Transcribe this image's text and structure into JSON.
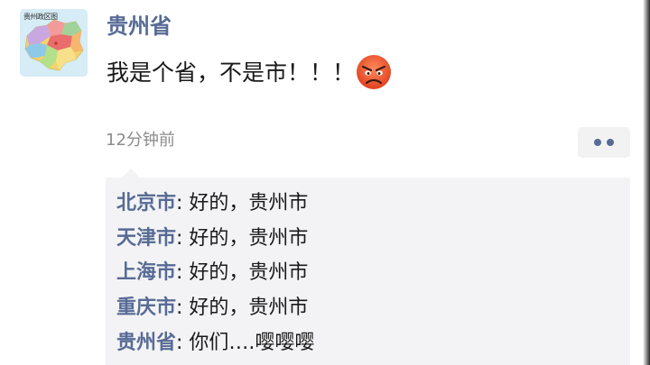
{
  "post": {
    "author": "贵州省",
    "avatar_caption": "贵州政区图",
    "text": "我是个省，不是市！！！",
    "emoji": "angry-face-icon",
    "time": "12分钟前"
  },
  "comments": [
    {
      "name": "北京市",
      "sep": ": ",
      "text": "好的，贵州市"
    },
    {
      "name": "天津市",
      "sep": ": ",
      "text": "好的，贵州市"
    },
    {
      "name": "上海市",
      "sep": ": ",
      "text": "好的，贵州市"
    },
    {
      "name": "重庆市",
      "sep": ": ",
      "text": "好的，贵州市"
    },
    {
      "name": "贵州省",
      "sep": ": ",
      "text": "你们….嘤嘤嘤"
    }
  ],
  "colors": {
    "name_link": "#576b95",
    "comment_bg": "#f3f3f5",
    "time_gray": "#8c8c8c"
  }
}
